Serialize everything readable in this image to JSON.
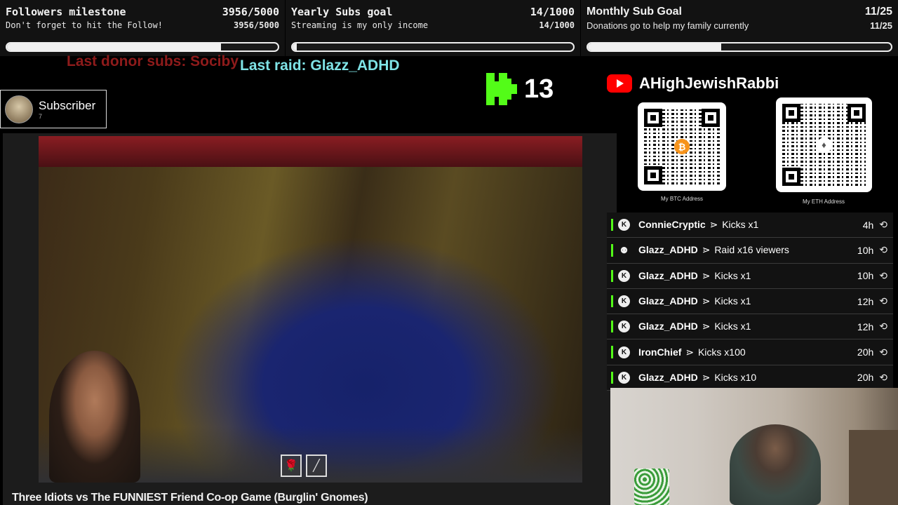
{
  "goals": [
    {
      "title": "Followers milestone",
      "count": "3956/5000",
      "subtitle": "Don't forget to hit the Follow!",
      "count2": "3956/5000",
      "progress": 0.7912
    },
    {
      "title": "Yearly Subs goal",
      "count": "14/1000",
      "subtitle": "Streaming is my only income",
      "count2": "14/1000",
      "progress": 0.014
    },
    {
      "title": "Monthly Sub Goal",
      "count": "11/25",
      "subtitle": "Donations go to help my family currently",
      "count2": "11/25",
      "progress": 0.44
    }
  ],
  "ticker": {
    "donor": "Last donor subs: Sociby",
    "raid": "Last raid: Glazz_ADHD"
  },
  "kick": {
    "icon": "kick-logo-icon",
    "count": "13",
    "color": "#53fc18"
  },
  "subscriber": {
    "label": "Subscriber",
    "count": "7"
  },
  "video": {
    "title": "Three Idiots vs The FUNNIEST Friend Co-op Game (Burglin' Gnomes)",
    "hotbar": [
      "🌹",
      "╱"
    ]
  },
  "channel": {
    "icon": "youtube-icon",
    "name": "AHighJewishRabbi"
  },
  "qr": [
    {
      "label": "My BTC Address",
      "symbol": "₿",
      "color": "#f7931a"
    },
    {
      "label": "My ETH Address",
      "symbol": "♦",
      "color": "#8a8a8a"
    }
  ],
  "events": [
    {
      "icon": "kick-icon",
      "user": "ConnieCryptic",
      "action": "Kicks x1",
      "time": "4h"
    },
    {
      "icon": "raid-icon",
      "user": "Glazz_ADHD",
      "action": "Raid x16 viewers",
      "time": "10h"
    },
    {
      "icon": "kick-icon",
      "user": "Glazz_ADHD",
      "action": "Kicks x1",
      "time": "10h"
    },
    {
      "icon": "kick-icon",
      "user": "Glazz_ADHD",
      "action": "Kicks x1",
      "time": "12h"
    },
    {
      "icon": "kick-icon",
      "user": "Glazz_ADHD",
      "action": "Kicks x1",
      "time": "12h"
    },
    {
      "icon": "kick-icon",
      "user": "IronChief",
      "action": "Kicks x100",
      "time": "20h"
    },
    {
      "icon": "kick-icon",
      "user": "Glazz_ADHD",
      "action": "Kicks x10",
      "time": "20h"
    }
  ],
  "event_separator": "⋗",
  "colors": {
    "accent": "#53fc18",
    "youtube": "#ff0000",
    "raid_text": "#7fe3e6",
    "donor_text": "#8e1b1b"
  }
}
